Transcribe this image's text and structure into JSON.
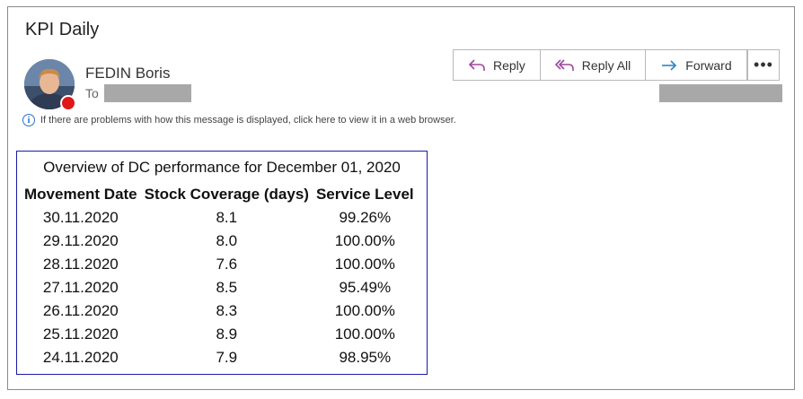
{
  "message": {
    "subject": "KPI Daily",
    "sender": "FEDIN Boris",
    "to_label": "To",
    "info_text": "If there are problems with how this message is displayed, click here to view it in a web browser."
  },
  "actions": {
    "reply": "Reply",
    "reply_all": "Reply All",
    "forward": "Forward",
    "more": "•••"
  },
  "report": {
    "title": "Overview of DC performance for December 01, 2020",
    "columns": [
      "Movement Date",
      "Stock Coverage (days)",
      "Service Level"
    ],
    "rows": [
      [
        "30.11.2020",
        "8.1",
        "99.26%"
      ],
      [
        "29.11.2020",
        "8.0",
        "100.00%"
      ],
      [
        "28.11.2020",
        "7.6",
        "100.00%"
      ],
      [
        "27.11.2020",
        "8.5",
        "95.49%"
      ],
      [
        "26.11.2020",
        "8.3",
        "100.00%"
      ],
      [
        "25.11.2020",
        "8.9",
        "100.00%"
      ],
      [
        "24.11.2020",
        "7.9",
        "98.95%"
      ]
    ]
  },
  "colors": {
    "accent_purple": "#a0479c",
    "accent_blue": "#2a86c9",
    "presence_busy": "#e01818",
    "report_border": "#1a1aaa"
  },
  "icons": [
    "reply-icon",
    "reply-all-icon",
    "forward-icon",
    "more-icon",
    "info-icon",
    "avatar"
  ]
}
